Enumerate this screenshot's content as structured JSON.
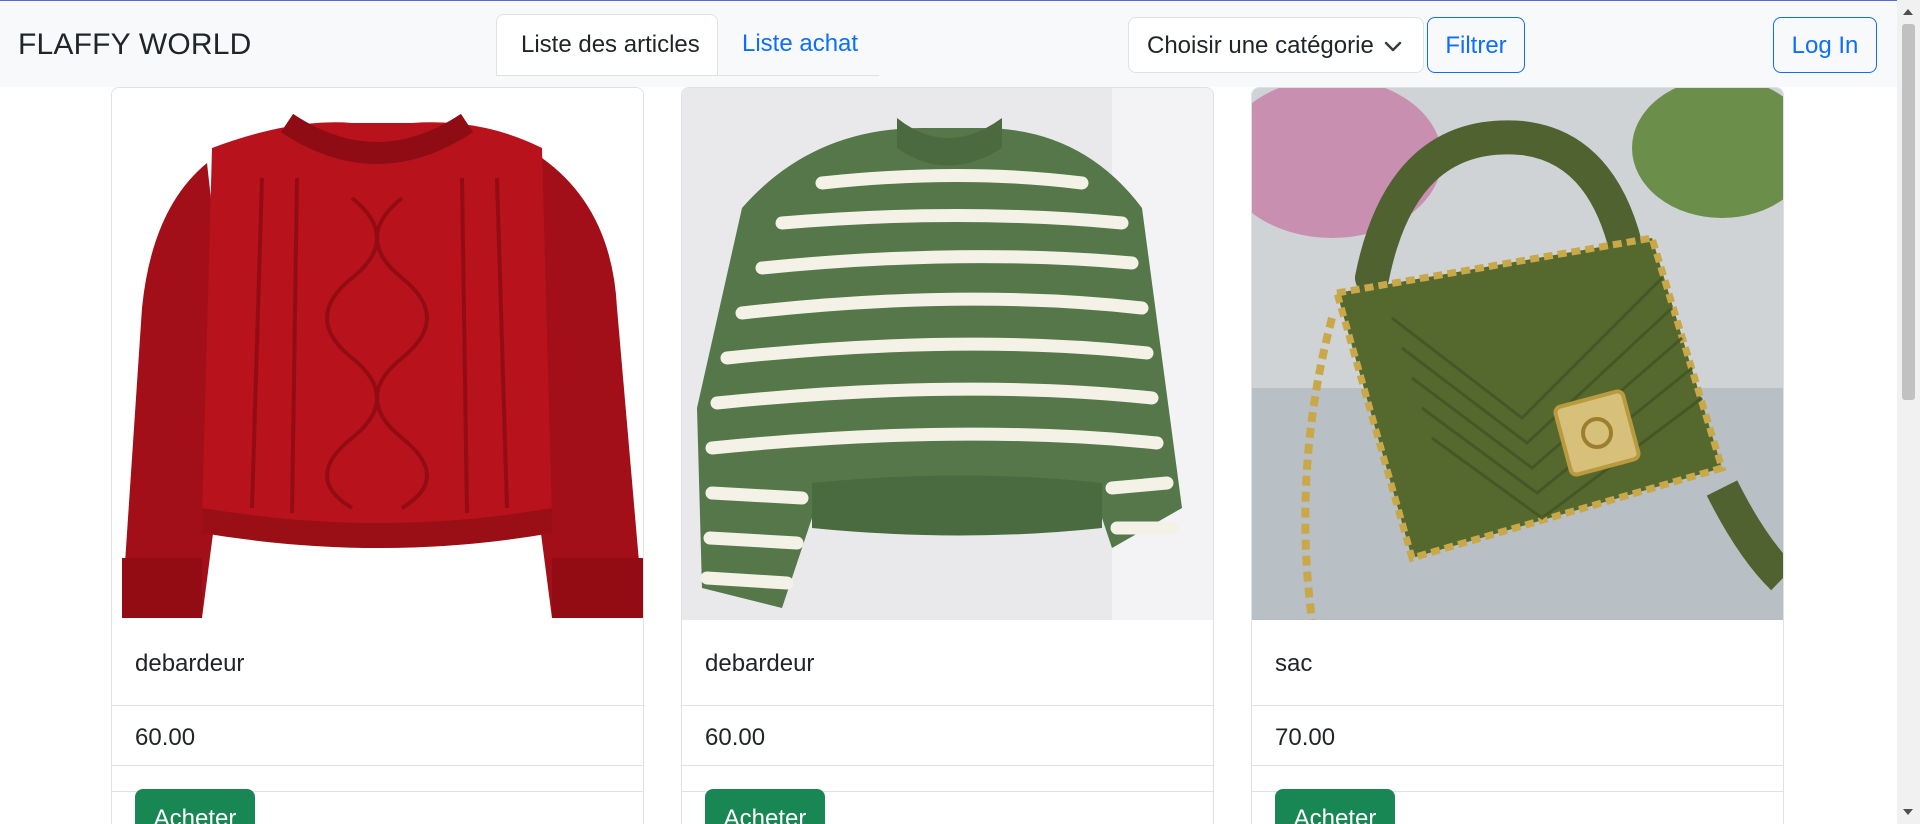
{
  "navbar": {
    "brand": "FLAFFY WORLD",
    "tabs": [
      {
        "label": "Liste des articles",
        "active": true
      },
      {
        "label": "Liste achat",
        "active": false
      }
    ],
    "category_select": {
      "selected": "Choisir une catégorie"
    },
    "filter_label": "Filtrer",
    "login_label": "Log In"
  },
  "products": [
    {
      "name": "debardeur",
      "price": "60.00",
      "buy_label": "Acheter",
      "image": "red cable-knit sweater",
      "color": "#b0121b"
    },
    {
      "name": "debardeur",
      "price": "60.00",
      "buy_label": "Acheter",
      "image": "green and white striped sweater",
      "color": "#5a7a45"
    },
    {
      "name": "sac",
      "price": "70.00",
      "buy_label": "Acheter",
      "image": "olive crochet handbag with gold chain",
      "color": "#556b2f"
    }
  ],
  "colors": {
    "accent": "#0d6efd",
    "success": "#198754",
    "navbar_bg": "#f8f9fa"
  }
}
